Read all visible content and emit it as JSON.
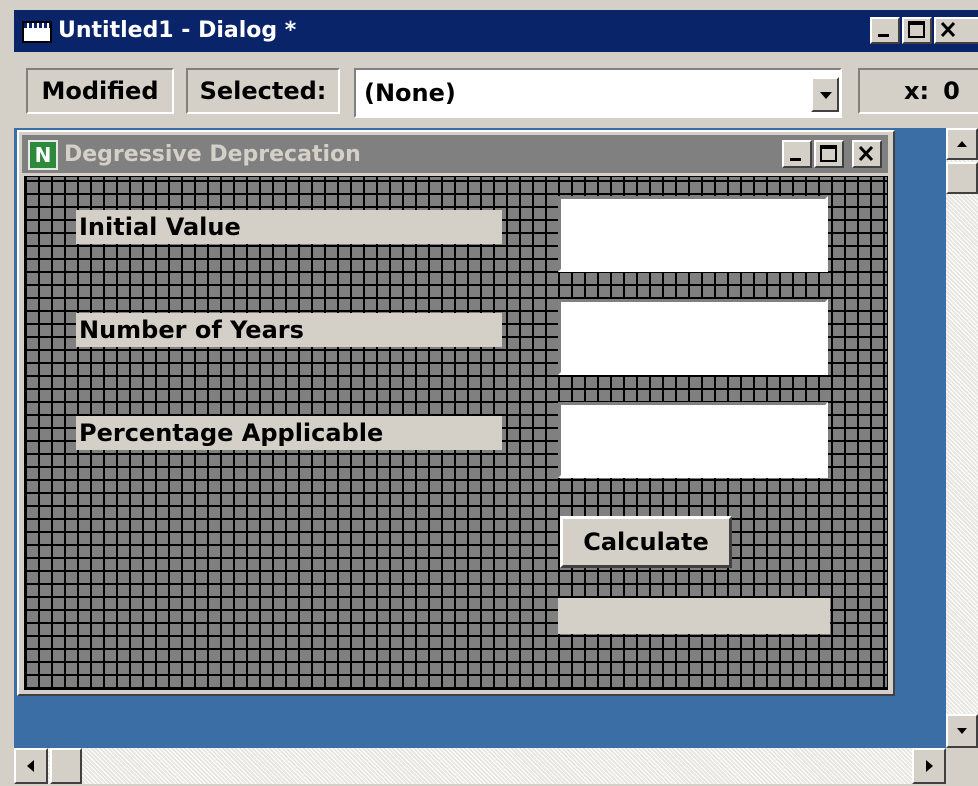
{
  "window": {
    "title": "Untitled1 - Dialog *"
  },
  "toolbar": {
    "modified_label": "Modified",
    "selected_label": "Selected:",
    "selected_value": "(None)",
    "x_label": "x:",
    "x_value": "0"
  },
  "dialog": {
    "title": "Degressive Deprecation",
    "icon_letter": "N",
    "fields": [
      {
        "label": "Initial Value",
        "value": ""
      },
      {
        "label": "Number of Years",
        "value": ""
      },
      {
        "label": "Percentage Applicable",
        "value": ""
      }
    ],
    "calculate_label": "Calculate",
    "result_value": ""
  },
  "colors": {
    "titlebar_active": "#0a246a",
    "titlebar_inactive": "#808080",
    "workspace": "#3a6ea5",
    "face": "#d4d0c8"
  }
}
